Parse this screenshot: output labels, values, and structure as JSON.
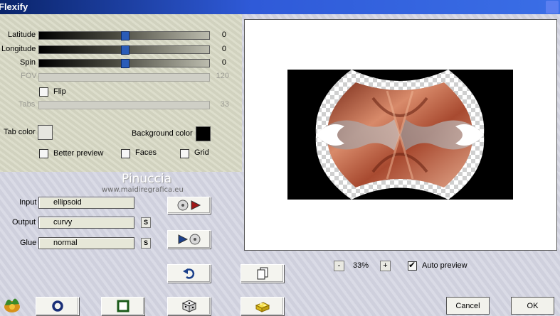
{
  "window": {
    "title": "Flexify"
  },
  "sliders": [
    {
      "label": "Latitude",
      "value": "0",
      "position": 0.5,
      "enabled": true
    },
    {
      "label": "Longitude",
      "value": "0",
      "position": 0.5,
      "enabled": true
    },
    {
      "label": "Spin",
      "value": "0",
      "position": 0.5,
      "enabled": true
    },
    {
      "label": "FOV",
      "value": "120",
      "enabled": false
    },
    {
      "label": "Tabs",
      "value": "33",
      "enabled": false
    }
  ],
  "flip": {
    "label": "Flip",
    "checked": false
  },
  "tab_color": {
    "label": "Tab color",
    "color": "#e6e6e0"
  },
  "background_color": {
    "label": "Background color",
    "color": "#000000"
  },
  "options": {
    "better_preview": {
      "label": "Better preview",
      "checked": false
    },
    "faces": {
      "label": "Faces",
      "checked": false
    },
    "grid": {
      "label": "Grid",
      "checked": false
    }
  },
  "watermark": {
    "name": "Pinuccia",
    "url": "www.maidiregrafica.eu"
  },
  "fields": {
    "input": {
      "label": "Input",
      "value": "ellipsoid"
    },
    "output": {
      "label": "Output",
      "value": "curvy",
      "s_label": "S"
    },
    "glue": {
      "label": "Glue",
      "value": "normal",
      "s_label": "S"
    }
  },
  "zoom": {
    "minus": "-",
    "value": "33%",
    "plus": "+"
  },
  "auto_preview": {
    "label": "Auto preview",
    "checked": true
  },
  "buttons": {
    "cancel": "Cancel",
    "ok": "OK"
  },
  "icons": [
    "import-icon",
    "export-icon",
    "undo-icon",
    "copy-icon",
    "logo-icon",
    "circle-icon",
    "square-icon",
    "dice-icon",
    "brick-icon"
  ]
}
